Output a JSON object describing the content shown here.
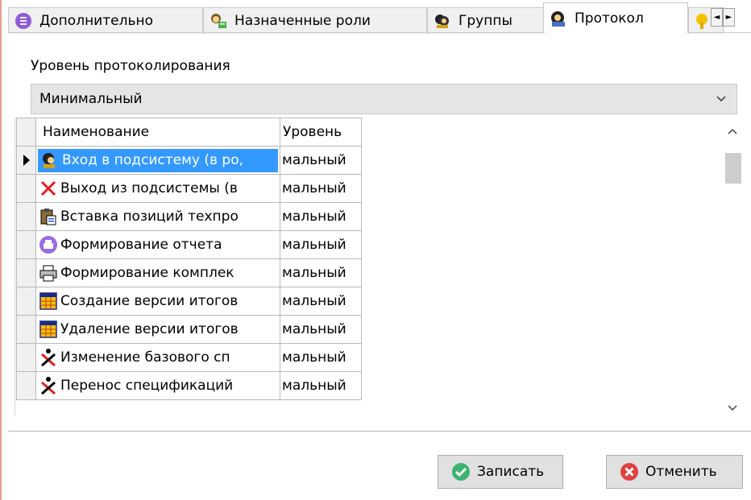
{
  "tabs": [
    {
      "label": "Дополнительно",
      "icon": "info-circle-icon",
      "active": false
    },
    {
      "label": "Назначенные роли",
      "icon": "user-roles-icon",
      "active": false
    },
    {
      "label": "Группы",
      "icon": "groups-icon",
      "active": false
    },
    {
      "label": "Протокол",
      "icon": "protocol-icon",
      "active": true
    },
    {
      "label": "",
      "icon": "key-icon",
      "active": false
    }
  ],
  "tab_scroll": {
    "left": "◄",
    "right": "►"
  },
  "logging": {
    "label": "Уровень протоколирования",
    "selected": "Минимальный"
  },
  "grid": {
    "columns": [
      "Наименование",
      "Уровень"
    ],
    "rows": [
      {
        "name": "Вход в подсистему (в ро,",
        "level": "мальный",
        "icon": "login-icon",
        "selected": true
      },
      {
        "name": "Выход из подсистемы (в",
        "level": "мальный",
        "icon": "red-x-icon",
        "selected": false
      },
      {
        "name": "Вставка позиций техпро",
        "level": "мальный",
        "icon": "clipboard-icon",
        "selected": false
      },
      {
        "name": "Формирование отчета",
        "level": "мальный",
        "icon": "report-icon",
        "selected": false
      },
      {
        "name": "Формирование комплек",
        "level": "мальный",
        "icon": "printer-icon",
        "selected": false
      },
      {
        "name": "Создание версии итогов",
        "level": "мальный",
        "icon": "table-icon",
        "selected": false
      },
      {
        "name": "Удаление версии итогов",
        "level": "мальный",
        "icon": "table-icon",
        "selected": false
      },
      {
        "name": "Изменение базового сп",
        "level": "мальный",
        "icon": "figure-x-icon",
        "selected": false
      },
      {
        "name": "Перенос спецификаций",
        "level": "мальный",
        "icon": "figure-x-icon",
        "selected": false
      }
    ]
  },
  "buttons": {
    "save": "Записать",
    "cancel": "Отменить"
  },
  "colors": {
    "selection": "#3399ff",
    "save_icon": "#3cb371",
    "cancel_icon": "#e04040"
  }
}
